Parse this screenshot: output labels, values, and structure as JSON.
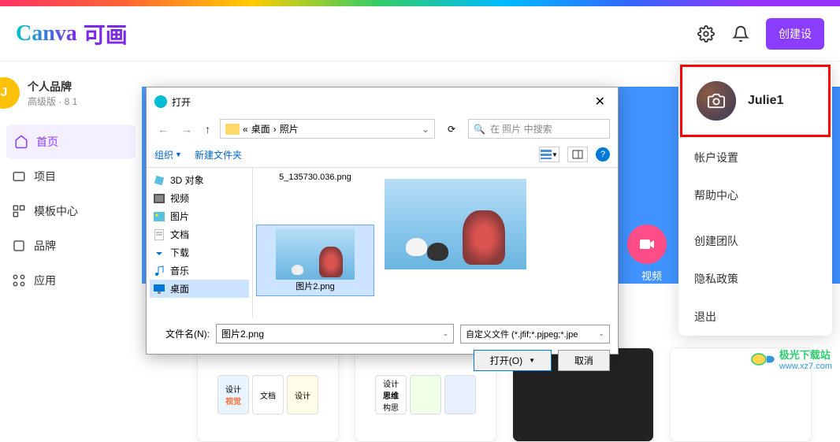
{
  "header": {
    "logo_canva": "Canva",
    "logo_cn": "可画",
    "create_btn": "创建设"
  },
  "sidebar": {
    "brand_name": "个人品牌",
    "brand_sub": "高级版 · 8 1",
    "items": [
      {
        "label": "首页",
        "active": true
      },
      {
        "label": "项目",
        "active": false
      },
      {
        "label": "模板中心",
        "active": false
      },
      {
        "label": "品牌",
        "active": false
      },
      {
        "label": "应用",
        "active": false
      }
    ]
  },
  "banner": {
    "video_label": "视频"
  },
  "user_menu": {
    "name": "Julie1",
    "items": [
      "帐户设置",
      "帮助中心",
      "创建团队",
      "隐私政策",
      "退出"
    ]
  },
  "dialog": {
    "title": "打开",
    "path_parts": [
      "«",
      "桌面",
      "›",
      "照片"
    ],
    "search_placeholder": "在 照片 中搜索",
    "organize": "组织",
    "new_folder": "新建文件夹",
    "tree": [
      {
        "label": "3D 对象",
        "icon": "3d"
      },
      {
        "label": "视频",
        "icon": "video"
      },
      {
        "label": "图片",
        "icon": "image"
      },
      {
        "label": "文档",
        "icon": "doc"
      },
      {
        "label": "下载",
        "icon": "download"
      },
      {
        "label": "音乐",
        "icon": "music"
      },
      {
        "label": "桌面",
        "icon": "desktop",
        "selected": true
      }
    ],
    "files": [
      {
        "name": "5_135730.036.png",
        "prefix": "",
        "selected": false
      },
      {
        "name": "图片2.png",
        "selected": true
      }
    ],
    "filename_label": "文件名(N):",
    "filename_value": "图片2.png",
    "filetype": "自定义文件 (*.jfif;*.pjpeg;*.jpe",
    "open_btn": "打开(O)",
    "cancel_btn": "取消"
  },
  "cards": {
    "c1a": "设计",
    "c1b": "视觉",
    "c1c": "文档",
    "c1d": "设计",
    "c2a": "设计",
    "c2b": "思维",
    "c2c": "构思"
  },
  "watermark": {
    "top": "极光下载站",
    "bottom": "www.xz7.com"
  }
}
